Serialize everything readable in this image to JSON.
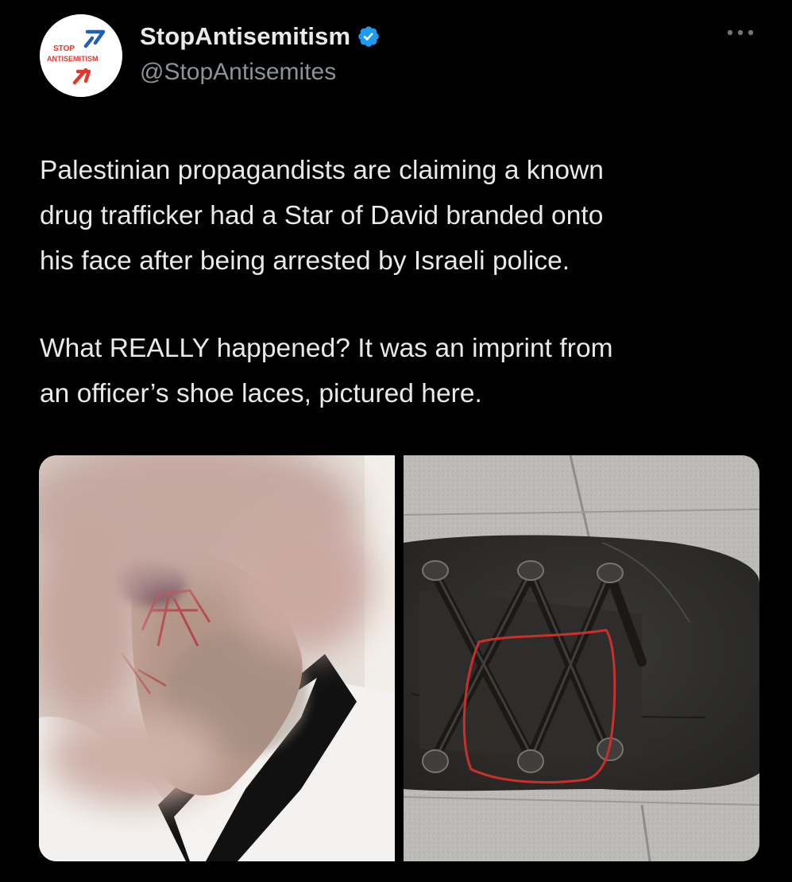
{
  "author": {
    "display_name": "StopAntisemitism",
    "handle": "@StopAntisemites",
    "avatar_text": {
      "line1": "STOP",
      "line2": "ANTISEMITISM"
    },
    "verified_icon": "verified-badge-icon"
  },
  "menu": {
    "icon": "more-horizontal-icon"
  },
  "tweet": {
    "paragraph_1": "Palestinian propagandists are claiming a known\ndrug trafficker had a Star of David branded onto\nhis face after being arrested by Israeli police.",
    "paragraph_2": "What REALLY happened? It was an imprint from\nan officer’s shoe laces, pictured here."
  },
  "media": {
    "count": 2,
    "items": [
      "photo-blurred-face-with-mark",
      "photo-shoe-laces-circled"
    ]
  },
  "colors": {
    "background": "#000000",
    "text": "#e7e9ea",
    "secondary_text": "#8b9298",
    "verified": "#1d9bf0",
    "brand_red": "#e0392b",
    "brand_blue": "#1f5fb8"
  }
}
